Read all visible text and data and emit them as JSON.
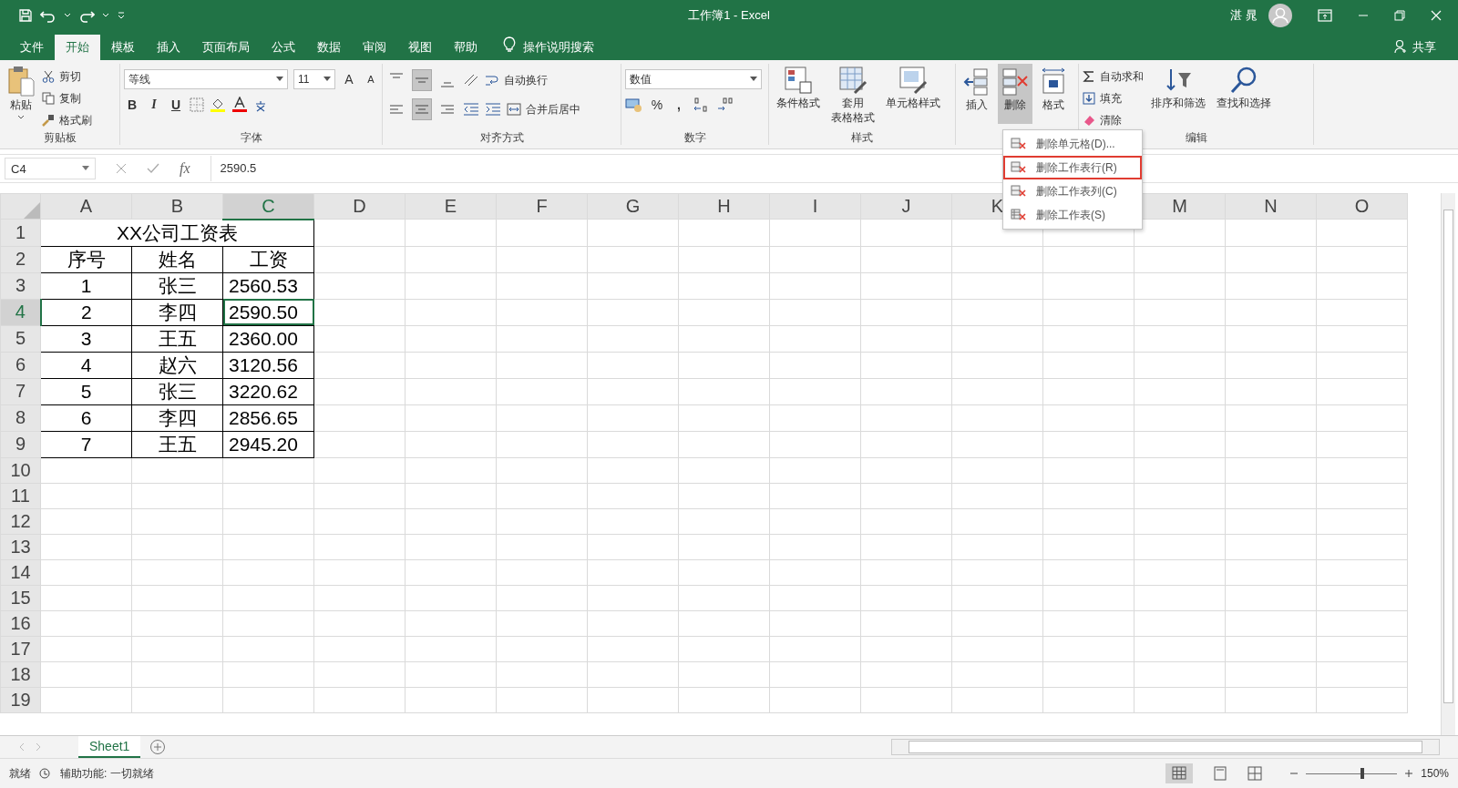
{
  "window": {
    "title": "工作簿1 - Excel",
    "user": "湛 晁"
  },
  "menu_tabs": [
    {
      "label": "文件",
      "selected": false
    },
    {
      "label": "开始",
      "selected": true
    },
    {
      "label": "模板",
      "selected": false
    },
    {
      "label": "插入",
      "selected": false
    },
    {
      "label": "页面布局",
      "selected": false
    },
    {
      "label": "公式",
      "selected": false
    },
    {
      "label": "数据",
      "selected": false
    },
    {
      "label": "审阅",
      "selected": false
    },
    {
      "label": "视图",
      "selected": false
    },
    {
      "label": "帮助",
      "selected": false
    }
  ],
  "tell_me": "操作说明搜索",
  "share": "共享",
  "ribbon": {
    "clipboard": {
      "label": "剪贴板",
      "paste": "粘贴",
      "cut": "剪切",
      "copy": "复制",
      "format_painter": "格式刷"
    },
    "font": {
      "label": "字体",
      "font_name": "等线",
      "font_size": "11",
      "grow": "A",
      "shrink": "A",
      "bold": "B",
      "italic": "I",
      "underline": "U"
    },
    "alignment": {
      "label": "对齐方式",
      "wrap_text": "自动换行",
      "merge_center": "合并后居中",
      "vertical": [
        {
          "selected": false
        },
        {
          "selected": true
        },
        {
          "selected": false
        }
      ],
      "horizontal": [
        {
          "selected": false
        },
        {
          "selected": true
        },
        {
          "selected": false
        }
      ]
    },
    "number": {
      "label": "数字",
      "format": "数值",
      "percent": "%",
      "comma": ","
    },
    "styles": {
      "label": "样式",
      "conditional": "条件格式",
      "table_format": [
        "套用",
        "表格格式"
      ],
      "cell_styles": "单元格样式"
    },
    "cells": {
      "insert": "插入",
      "delete": "删除",
      "delete_open": true,
      "format": "格式"
    },
    "editing": {
      "label": "编辑",
      "autosum": "自动求和",
      "fill": "填充",
      "clear": "清除",
      "sort_filter": "排序和筛选",
      "find_select": "查找和选择"
    }
  },
  "delete_menu": [
    {
      "label": "删除单元格(D)...",
      "highlighted": false
    },
    {
      "label": "删除工作表行(R)",
      "highlighted": true
    },
    {
      "label": "删除工作表列(C)",
      "highlighted": false
    },
    {
      "label": "删除工作表(S)",
      "highlighted": false
    }
  ],
  "formula_bar": {
    "name_box": "C4",
    "fx": "fx",
    "value": "2590.5"
  },
  "sheet": {
    "columns": [
      {
        "label": "A",
        "selected": false
      },
      {
        "label": "B",
        "selected": false
      },
      {
        "label": "C",
        "selected": true
      },
      {
        "label": "D",
        "selected": false
      },
      {
        "label": "E",
        "selected": false
      },
      {
        "label": "F",
        "selected": false
      },
      {
        "label": "G",
        "selected": false
      },
      {
        "label": "H",
        "selected": false
      },
      {
        "label": "I",
        "selected": false
      },
      {
        "label": "J",
        "selected": false
      },
      {
        "label": "K",
        "selected": false
      },
      {
        "label": "M",
        "selected": false
      },
      {
        "label": "N",
        "selected": false
      },
      {
        "label": "O",
        "selected": false
      }
    ],
    "rows": [
      {
        "label": "1",
        "selected": false,
        "kind": "title",
        "title": "XX公司工资表"
      },
      {
        "label": "2",
        "selected": false,
        "kind": "data",
        "cells": [
          "序号",
          "姓名",
          "工资"
        ]
      },
      {
        "label": "3",
        "selected": false,
        "kind": "data",
        "cells": [
          "1",
          "张三",
          "2560.53"
        ]
      },
      {
        "label": "4",
        "selected": true,
        "kind": "data",
        "cells": [
          "2",
          "李四",
          "2590.50"
        ]
      },
      {
        "label": "5",
        "selected": false,
        "kind": "data",
        "cells": [
          "3",
          "王五",
          "2360.00"
        ]
      },
      {
        "label": "6",
        "selected": false,
        "kind": "data",
        "cells": [
          "4",
          "赵六",
          "3120.56"
        ]
      },
      {
        "label": "7",
        "selected": false,
        "kind": "data",
        "cells": [
          "5",
          "张三",
          "3220.62"
        ]
      },
      {
        "label": "8",
        "selected": false,
        "kind": "data",
        "cells": [
          "6",
          "李四",
          "2856.65"
        ]
      },
      {
        "label": "9",
        "selected": false,
        "kind": "data",
        "cells": [
          "7",
          "王五",
          "2945.20"
        ]
      },
      {
        "label": "10",
        "selected": false,
        "kind": "empty"
      },
      {
        "label": "11",
        "selected": false,
        "kind": "empty"
      },
      {
        "label": "12",
        "selected": false,
        "kind": "empty"
      },
      {
        "label": "13",
        "selected": false,
        "kind": "empty"
      },
      {
        "label": "14",
        "selected": false,
        "kind": "empty"
      },
      {
        "label": "15",
        "selected": false,
        "kind": "empty"
      },
      {
        "label": "16",
        "selected": false,
        "kind": "empty"
      },
      {
        "label": "17",
        "selected": false,
        "kind": "empty"
      },
      {
        "label": "18",
        "selected": false,
        "kind": "empty"
      },
      {
        "label": "19",
        "selected": false,
        "kind": "empty"
      }
    ]
  },
  "sheet_tabs": [
    {
      "label": "Sheet1",
      "selected": true
    }
  ],
  "status_bar": {
    "ready": "就绪",
    "accessibility": "辅助功能: 一切就绪",
    "zoom": "150%",
    "zoom_slider": {
      "level": 0.6
    }
  }
}
